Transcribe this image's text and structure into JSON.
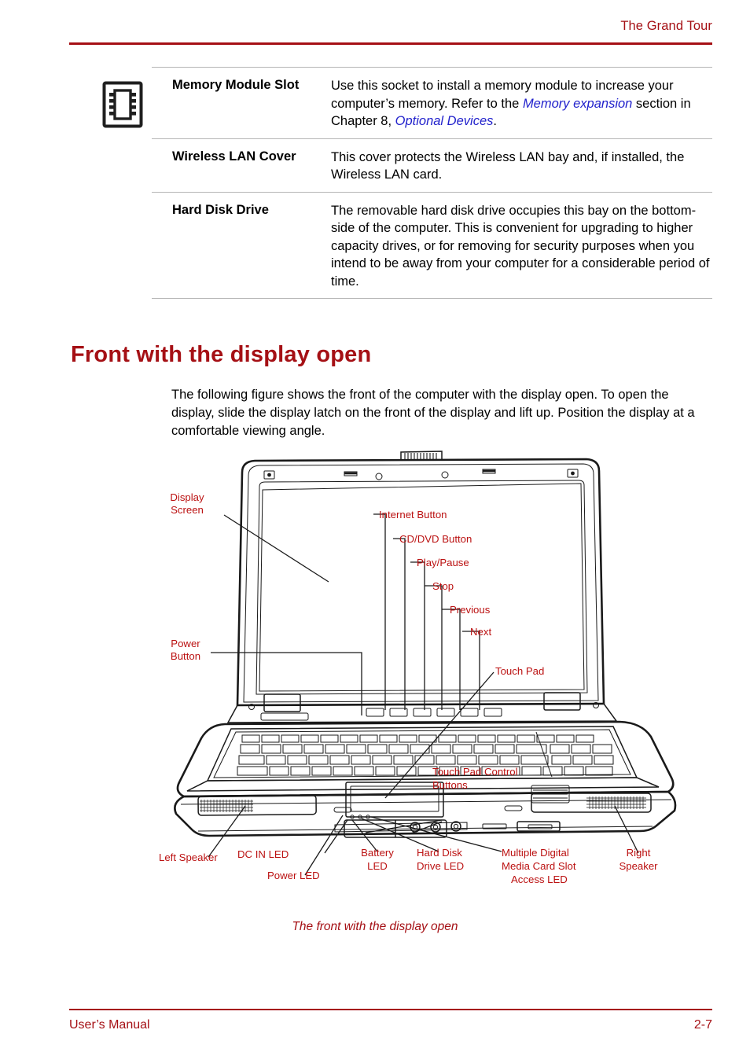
{
  "header": {
    "title": "The Grand Tour"
  },
  "spec_table": {
    "rows": [
      {
        "icon": "memory-chip-icon",
        "term": "Memory Module Slot",
        "desc_parts": [
          {
            "text": "Use this socket to install a memory module to increase your computer’s memory. Refer to the ",
            "style": "normal"
          },
          {
            "text": "Memory expansion",
            "style": "italic-blue"
          },
          {
            "text": " section in Chapter 8, ",
            "style": "normal"
          },
          {
            "text": "Optional Devices",
            "style": "italic-blue"
          },
          {
            "text": ".",
            "style": "normal"
          }
        ]
      },
      {
        "icon": "",
        "term": "Wireless LAN Cover",
        "desc_parts": [
          {
            "text": "This cover protects the Wireless LAN bay and, if installed, the Wireless LAN card.",
            "style": "normal"
          }
        ]
      },
      {
        "icon": "",
        "term": "Hard Disk Drive",
        "desc_parts": [
          {
            "text": "The removable hard disk drive occupies this bay on the bottom-side of the computer. This is convenient for upgrading to higher capacity drives, or for removing for security purposes when you intend to be away from your computer for a considerable period of time.",
            "style": "normal"
          }
        ]
      }
    ]
  },
  "section": {
    "heading": "Front with the display open",
    "intro": "The following figure shows the front of the computer with the display open. To open the display, slide the display latch on the front of the display and lift up. Position the display at a comfortable viewing angle."
  },
  "figure": {
    "caption": "The front with the display open",
    "callouts": {
      "display_screen_line1": "Display",
      "display_screen_line2": "Screen",
      "power_button_line1": "Power",
      "power_button_line2": "Button",
      "internet_button": "Internet Button",
      "cd_dvd_button": "CD/DVD Button",
      "play_pause": "Play/Pause",
      "stop": "Stop",
      "previous": "Previous",
      "next": "Next",
      "touch_pad": "Touch Pad",
      "touch_pad_control_line1": "Touch Pad Control",
      "touch_pad_control_line2": "Buttons",
      "dc_in_led": "DC IN LED",
      "left_speaker": "Left Speaker",
      "power_led": "Power LED",
      "battery_led_line1": "Battery",
      "battery_led_line2": "LED",
      "hard_disk_led_line1": "Hard Disk",
      "hard_disk_led_line2": "Drive LED",
      "media_card_line1": "Multiple Digital",
      "media_card_line2": "Media Card Slot",
      "media_card_line3": "Access LED",
      "right_speaker_line1": "Right",
      "right_speaker_line2": "Speaker"
    }
  },
  "footer": {
    "left": "User’s Manual",
    "right": "2-7"
  },
  "colors": {
    "accent_red": "#a51015",
    "callout_red": "#bb1111",
    "link_blue": "#2222cc",
    "rule_gray": "#b5b5b5"
  }
}
